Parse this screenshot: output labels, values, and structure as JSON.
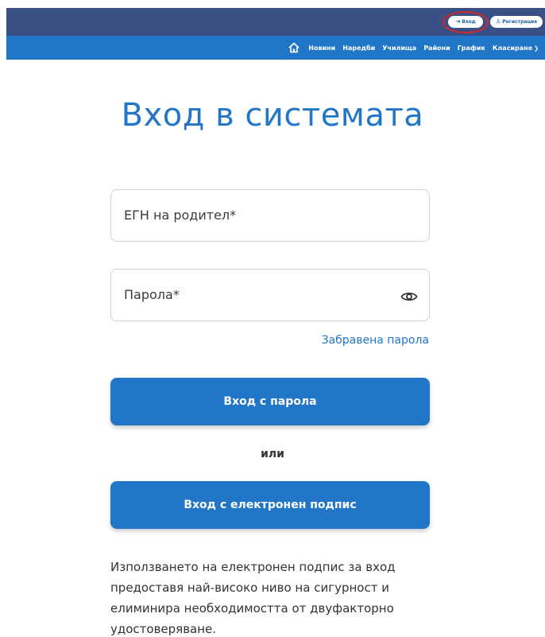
{
  "topbar": {
    "login_label": "Вход",
    "register_label": "Регистрация",
    "login_icon": "login-icon",
    "register_icon": "user-icon",
    "highlight_color": "#d62828"
  },
  "nav": {
    "home_icon": "home-icon",
    "items": [
      "Новини",
      "Наредби",
      "Училища",
      "Райони",
      "График",
      "Класиране"
    ]
  },
  "colors": {
    "primary": "#2176c7",
    "topbar": "#3a4f86"
  },
  "page": {
    "title": "Вход в системата"
  },
  "form": {
    "egn_placeholder": "ЕГН на родител*",
    "password_placeholder": "Парола*",
    "forgot_password": "Забравена парола",
    "login_password_button": "Вход с парола",
    "or_label": "или",
    "login_esign_button": "Вход с електронен подпис",
    "note": "Използването на електронен подпис за вход предоставя най-високо ниво на сигурност и елиминира необходимостта от двуфакторно удостоверяване."
  }
}
